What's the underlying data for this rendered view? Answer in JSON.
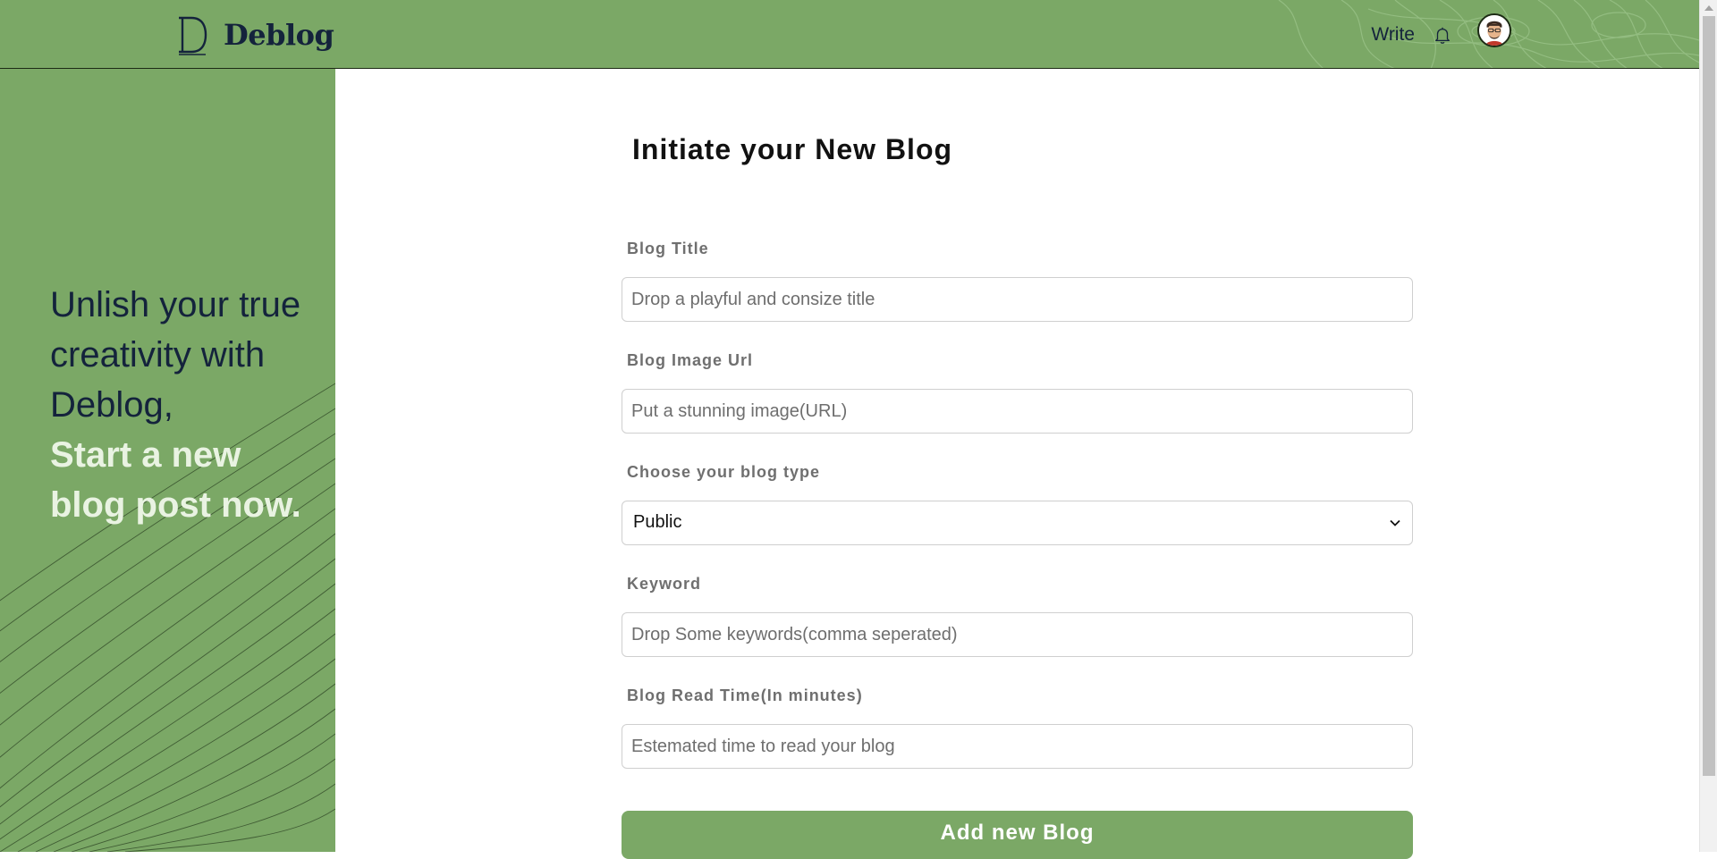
{
  "header": {
    "brand_name": "Deblog",
    "brand_mark_letter": "D",
    "write_label": "Write",
    "icons": {
      "bell": "bell-icon",
      "avatar": "user-avatar"
    }
  },
  "side": {
    "tagline_regular": "Unlish your true creativity with Deblog,",
    "tagline_bold": "Start a new blog post now."
  },
  "form": {
    "title": "Initiate your New Blog",
    "fields": [
      {
        "label": "Blog Title",
        "placeholder": "Drop a playful and consize title"
      },
      {
        "label": "Blog Image Url",
        "placeholder": "Put a stunning image(URL)"
      },
      {
        "label": "Choose your blog type",
        "selected": "Public"
      },
      {
        "label": "Keyword",
        "placeholder": "Drop Some keywords(comma seperated)"
      },
      {
        "label": "Blog Read Time(In minutes)",
        "placeholder": "Estemated time to read your blog"
      }
    ],
    "submit_label": "Add new Blog"
  },
  "colors": {
    "accent_green": "#7ba866",
    "navy": "#14233c",
    "label_gray": "#6f6f6f",
    "tagline_highlight": "#e9f3e2"
  }
}
